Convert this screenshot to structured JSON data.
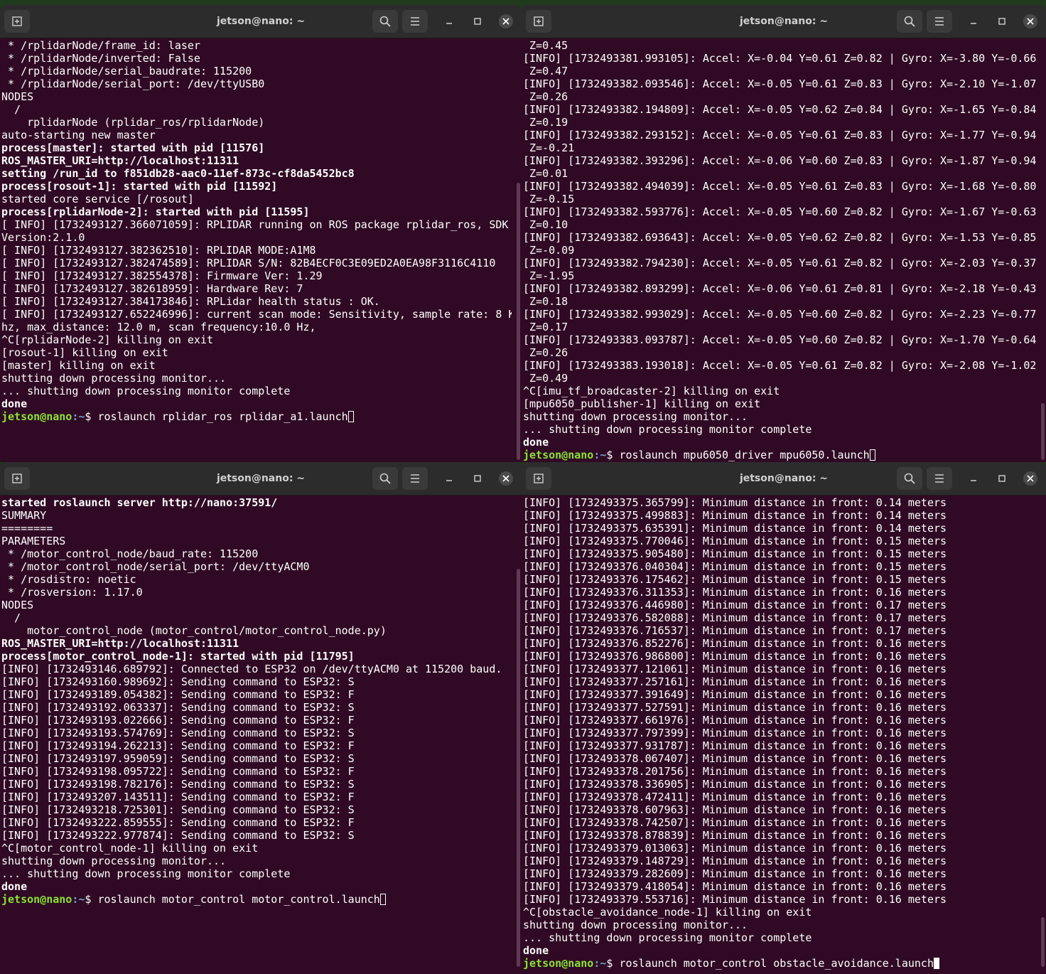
{
  "windows": {
    "tl": {
      "title": "jetson@nano: ~",
      "lines": [
        {
          "t": " * /rplidarNode/frame_id: laser",
          "b": false
        },
        {
          "t": " * /rplidarNode/inverted: False",
          "b": false
        },
        {
          "t": " * /rplidarNode/serial_baudrate: 115200",
          "b": false
        },
        {
          "t": " * /rplidarNode/serial_port: /dev/ttyUSB0",
          "b": false
        },
        {
          "t": "",
          "b": false
        },
        {
          "t": "NODES",
          "b": false
        },
        {
          "t": "  /",
          "b": false
        },
        {
          "t": "    rplidarNode (rplidar_ros/rplidarNode)",
          "b": false
        },
        {
          "t": "",
          "b": false
        },
        {
          "t": "auto-starting new master",
          "b": false
        },
        {
          "t": "process[master]: started with pid [11576]",
          "b": true
        },
        {
          "t": "ROS_MASTER_URI=http://localhost:11311",
          "b": true
        },
        {
          "t": "",
          "b": false
        },
        {
          "t": "setting /run_id to f851db28-aac0-11ef-873c-cf8da5452bc8",
          "b": true
        },
        {
          "t": "process[rosout-1]: started with pid [11592]",
          "b": true
        },
        {
          "t": "started core service [/rosout]",
          "b": false
        },
        {
          "t": "process[rplidarNode-2]: started with pid [11595]",
          "b": true
        },
        {
          "t": "[ INFO] [1732493127.366071059]: RPLIDAR running on ROS package rplidar_ros, SDK",
          "b": false
        },
        {
          "t": "Version:2.1.0",
          "b": false
        },
        {
          "t": "[ INFO] [1732493127.382362510]: RPLIDAR MODE:A1M8",
          "b": false
        },
        {
          "t": "[ INFO] [1732493127.382474589]: RPLIDAR S/N: 82B4ECF0C3E09ED2A0EA98F3116C4110",
          "b": false
        },
        {
          "t": "[ INFO] [1732493127.382554378]: Firmware Ver: 1.29",
          "b": false
        },
        {
          "t": "[ INFO] [1732493127.382618959]: Hardware Rev: 7",
          "b": false
        },
        {
          "t": "[ INFO] [1732493127.384173846]: RPLidar health status : OK.",
          "b": false
        },
        {
          "t": "[ INFO] [1732493127.652246996]: current scan mode: Sensitivity, sample rate: 8 K",
          "b": false
        },
        {
          "t": "hz, max_distance: 12.0 m, scan frequency:10.0 Hz,",
          "b": false
        },
        {
          "t": "^C[rplidarNode-2] killing on exit",
          "b": false
        },
        {
          "t": "[rosout-1] killing on exit",
          "b": false
        },
        {
          "t": "[master] killing on exit",
          "b": false
        },
        {
          "t": "shutting down processing monitor...",
          "b": false
        },
        {
          "t": "... shutting down processing monitor complete",
          "b": false
        },
        {
          "t": "done",
          "b": true
        }
      ],
      "prompt_user": "jetson@nano",
      "prompt_path": ":~",
      "prompt_symbol": "$ ",
      "command": "roslaunch rplidar_ros rplidar_a1.launch"
    },
    "tr": {
      "title": "jetson@nano: ~",
      "lines": [
        {
          "t": " Z=0.45",
          "b": false
        },
        {
          "t": "[INFO] [1732493381.993105]: Accel: X=-0.04 Y=0.61 Z=0.82 | Gyro: X=-3.80 Y=-0.66",
          "b": false
        },
        {
          "t": " Z=0.47",
          "b": false
        },
        {
          "t": "[INFO] [1732493382.093546]: Accel: X=-0.05 Y=0.61 Z=0.83 | Gyro: X=-2.10 Y=-1.07",
          "b": false
        },
        {
          "t": " Z=0.26",
          "b": false
        },
        {
          "t": "[INFO] [1732493382.194809]: Accel: X=-0.05 Y=0.62 Z=0.84 | Gyro: X=-1.65 Y=-0.84",
          "b": false
        },
        {
          "t": " Z=0.19",
          "b": false
        },
        {
          "t": "[INFO] [1732493382.293152]: Accel: X=-0.05 Y=0.61 Z=0.83 | Gyro: X=-1.77 Y=-0.94",
          "b": false
        },
        {
          "t": " Z=-0.21",
          "b": false
        },
        {
          "t": "[INFO] [1732493382.393296]: Accel: X=-0.06 Y=0.60 Z=0.83 | Gyro: X=-1.87 Y=-0.94",
          "b": false
        },
        {
          "t": " Z=0.01",
          "b": false
        },
        {
          "t": "[INFO] [1732493382.494039]: Accel: X=-0.05 Y=0.61 Z=0.83 | Gyro: X=-1.68 Y=-0.80",
          "b": false
        },
        {
          "t": " Z=-0.15",
          "b": false
        },
        {
          "t": "[INFO] [1732493382.593776]: Accel: X=-0.05 Y=0.60 Z=0.82 | Gyro: X=-1.67 Y=-0.63",
          "b": false
        },
        {
          "t": " Z=0.10",
          "b": false
        },
        {
          "t": "[INFO] [1732493382.693643]: Accel: X=-0.05 Y=0.62 Z=0.82 | Gyro: X=-1.53 Y=-0.85",
          "b": false
        },
        {
          "t": " Z=-0.09",
          "b": false
        },
        {
          "t": "[INFO] [1732493382.794230]: Accel: X=-0.05 Y=0.61 Z=0.82 | Gyro: X=-2.03 Y=-0.37",
          "b": false
        },
        {
          "t": " Z=-1.95",
          "b": false
        },
        {
          "t": "[INFO] [1732493382.893299]: Accel: X=-0.06 Y=0.61 Z=0.81 | Gyro: X=-2.18 Y=-0.43",
          "b": false
        },
        {
          "t": " Z=0.18",
          "b": false
        },
        {
          "t": "[INFO] [1732493382.993029]: Accel: X=-0.05 Y=0.60 Z=0.82 | Gyro: X=-2.23 Y=-0.77",
          "b": false
        },
        {
          "t": " Z=0.17",
          "b": false
        },
        {
          "t": "[INFO] [1732493383.093787]: Accel: X=-0.05 Y=0.60 Z=0.82 | Gyro: X=-1.70 Y=-0.64",
          "b": false
        },
        {
          "t": " Z=0.26",
          "b": false
        },
        {
          "t": "[INFO] [1732493383.193018]: Accel: X=-0.05 Y=0.61 Z=0.82 | Gyro: X=-2.08 Y=-1.02",
          "b": false
        },
        {
          "t": " Z=0.49",
          "b": false
        },
        {
          "t": "^C[imu_tf_broadcaster-2] killing on exit",
          "b": false
        },
        {
          "t": "[mpu6050_publisher-1] killing on exit",
          "b": false
        },
        {
          "t": "shutting down processing monitor...",
          "b": false
        },
        {
          "t": "... shutting down processing monitor complete",
          "b": false
        },
        {
          "t": "done",
          "b": true
        }
      ],
      "prompt_user": "jetson@nano",
      "prompt_path": ":~",
      "prompt_symbol": "$ ",
      "command": "roslaunch mpu6050_driver mpu6050.launch"
    },
    "bl": {
      "title": "jetson@nano: ~",
      "lines": [
        {
          "t": "started roslaunch server http://nano:37591/",
          "b": true
        },
        {
          "t": "",
          "b": false
        },
        {
          "t": "SUMMARY",
          "b": false
        },
        {
          "t": "========",
          "b": false
        },
        {
          "t": "",
          "b": false
        },
        {
          "t": "PARAMETERS",
          "b": false
        },
        {
          "t": " * /motor_control_node/baud_rate: 115200",
          "b": false
        },
        {
          "t": " * /motor_control_node/serial_port: /dev/ttyACM0",
          "b": false
        },
        {
          "t": " * /rosdistro: noetic",
          "b": false
        },
        {
          "t": " * /rosversion: 1.17.0",
          "b": false
        },
        {
          "t": "",
          "b": false
        },
        {
          "t": "NODES",
          "b": false
        },
        {
          "t": "  /",
          "b": false
        },
        {
          "t": "    motor_control_node (motor_control/motor_control_node.py)",
          "b": false
        },
        {
          "t": "",
          "b": false
        },
        {
          "t": "ROS_MASTER_URI=http://localhost:11311",
          "b": true
        },
        {
          "t": "",
          "b": false
        },
        {
          "t": "process[motor_control_node-1]: started with pid [11795]",
          "b": true
        },
        {
          "t": "[INFO] [1732493146.689792]: Connected to ESP32 on /dev/ttyACM0 at 115200 baud.",
          "b": false
        },
        {
          "t": "[INFO] [1732493160.989692]: Sending command to ESP32: S",
          "b": false
        },
        {
          "t": "[INFO] [1732493189.054382]: Sending command to ESP32: F",
          "b": false
        },
        {
          "t": "[INFO] [1732493192.063337]: Sending command to ESP32: S",
          "b": false
        },
        {
          "t": "[INFO] [1732493193.022666]: Sending command to ESP32: F",
          "b": false
        },
        {
          "t": "[INFO] [1732493193.574769]: Sending command to ESP32: S",
          "b": false
        },
        {
          "t": "[INFO] [1732493194.262213]: Sending command to ESP32: F",
          "b": false
        },
        {
          "t": "[INFO] [1732493197.959059]: Sending command to ESP32: S",
          "b": false
        },
        {
          "t": "[INFO] [1732493198.095722]: Sending command to ESP32: F",
          "b": false
        },
        {
          "t": "[INFO] [1732493198.782176]: Sending command to ESP32: S",
          "b": false
        },
        {
          "t": "[INFO] [1732493207.143511]: Sending command to ESP32: F",
          "b": false
        },
        {
          "t": "[INFO] [1732493218.725301]: Sending command to ESP32: S",
          "b": false
        },
        {
          "t": "[INFO] [1732493222.859555]: Sending command to ESP32: F",
          "b": false
        },
        {
          "t": "[INFO] [1732493222.977874]: Sending command to ESP32: S",
          "b": false
        },
        {
          "t": "^C[motor_control_node-1] killing on exit",
          "b": false
        },
        {
          "t": "shutting down processing monitor...",
          "b": false
        },
        {
          "t": "... shutting down processing monitor complete",
          "b": false
        },
        {
          "t": "done",
          "b": true
        }
      ],
      "prompt_user": "jetson@nano",
      "prompt_path": ":~",
      "prompt_symbol": "$ ",
      "command": "roslaunch motor_control motor_control.launch"
    },
    "br": {
      "title": "jetson@nano: ~",
      "lines": [
        {
          "t": "[INFO] [1732493375.365799]: Minimum distance in front: 0.14 meters",
          "b": false
        },
        {
          "t": "[INFO] [1732493375.499883]: Minimum distance in front: 0.14 meters",
          "b": false
        },
        {
          "t": "[INFO] [1732493375.635391]: Minimum distance in front: 0.14 meters",
          "b": false
        },
        {
          "t": "[INFO] [1732493375.770046]: Minimum distance in front: 0.15 meters",
          "b": false
        },
        {
          "t": "[INFO] [1732493375.905480]: Minimum distance in front: 0.15 meters",
          "b": false
        },
        {
          "t": "[INFO] [1732493376.040304]: Minimum distance in front: 0.15 meters",
          "b": false
        },
        {
          "t": "[INFO] [1732493376.175462]: Minimum distance in front: 0.15 meters",
          "b": false
        },
        {
          "t": "[INFO] [1732493376.311353]: Minimum distance in front: 0.16 meters",
          "b": false
        },
        {
          "t": "[INFO] [1732493376.446980]: Minimum distance in front: 0.17 meters",
          "b": false
        },
        {
          "t": "[INFO] [1732493376.582088]: Minimum distance in front: 0.17 meters",
          "b": false
        },
        {
          "t": "[INFO] [1732493376.716537]: Minimum distance in front: 0.17 meters",
          "b": false
        },
        {
          "t": "[INFO] [1732493376.852276]: Minimum distance in front: 0.16 meters",
          "b": false
        },
        {
          "t": "[INFO] [1732493376.986800]: Minimum distance in front: 0.16 meters",
          "b": false
        },
        {
          "t": "[INFO] [1732493377.121061]: Minimum distance in front: 0.16 meters",
          "b": false
        },
        {
          "t": "[INFO] [1732493377.257161]: Minimum distance in front: 0.16 meters",
          "b": false
        },
        {
          "t": "[INFO] [1732493377.391649]: Minimum distance in front: 0.16 meters",
          "b": false
        },
        {
          "t": "[INFO] [1732493377.527591]: Minimum distance in front: 0.16 meters",
          "b": false
        },
        {
          "t": "[INFO] [1732493377.661976]: Minimum distance in front: 0.16 meters",
          "b": false
        },
        {
          "t": "[INFO] [1732493377.797399]: Minimum distance in front: 0.16 meters",
          "b": false
        },
        {
          "t": "[INFO] [1732493377.931787]: Minimum distance in front: 0.16 meters",
          "b": false
        },
        {
          "t": "[INFO] [1732493378.067407]: Minimum distance in front: 0.16 meters",
          "b": false
        },
        {
          "t": "[INFO] [1732493378.201756]: Minimum distance in front: 0.16 meters",
          "b": false
        },
        {
          "t": "[INFO] [1732493378.336905]: Minimum distance in front: 0.16 meters",
          "b": false
        },
        {
          "t": "[INFO] [1732493378.472411]: Minimum distance in front: 0.16 meters",
          "b": false
        },
        {
          "t": "[INFO] [1732493378.607963]: Minimum distance in front: 0.16 meters",
          "b": false
        },
        {
          "t": "[INFO] [1732493378.742507]: Minimum distance in front: 0.16 meters",
          "b": false
        },
        {
          "t": "[INFO] [1732493378.878839]: Minimum distance in front: 0.16 meters",
          "b": false
        },
        {
          "t": "[INFO] [1732493379.013063]: Minimum distance in front: 0.16 meters",
          "b": false
        },
        {
          "t": "[INFO] [1732493379.148729]: Minimum distance in front: 0.16 meters",
          "b": false
        },
        {
          "t": "[INFO] [1732493379.282609]: Minimum distance in front: 0.16 meters",
          "b": false
        },
        {
          "t": "[INFO] [1732493379.418054]: Minimum distance in front: 0.16 meters",
          "b": false
        },
        {
          "t": "[INFO] [1732493379.553716]: Minimum distance in front: 0.16 meters",
          "b": false
        },
        {
          "t": "^C[obstacle_avoidance_node-1] killing on exit",
          "b": false
        },
        {
          "t": "shutting down processing monitor...",
          "b": false
        },
        {
          "t": "... shutting down processing monitor complete",
          "b": false
        },
        {
          "t": "done",
          "b": true
        }
      ],
      "prompt_user": "jetson@nano",
      "prompt_path": ":~",
      "prompt_symbol": "$ ",
      "command": "roslaunch motor_control obstacle_avoidance.launch"
    }
  },
  "icons": {
    "new_tab": "new-tab-icon",
    "search": "search-icon",
    "menu": "hamburger-menu-icon",
    "minimize": "minimize-icon",
    "maximize": "maximize-icon",
    "close": "close-icon"
  },
  "colors": {
    "terminal_bg": "#300a24",
    "titlebar_bg": "#2c2c2c",
    "prompt_user": "#8ae234",
    "prompt_path": "#729fcf",
    "text": "#ffffff"
  }
}
